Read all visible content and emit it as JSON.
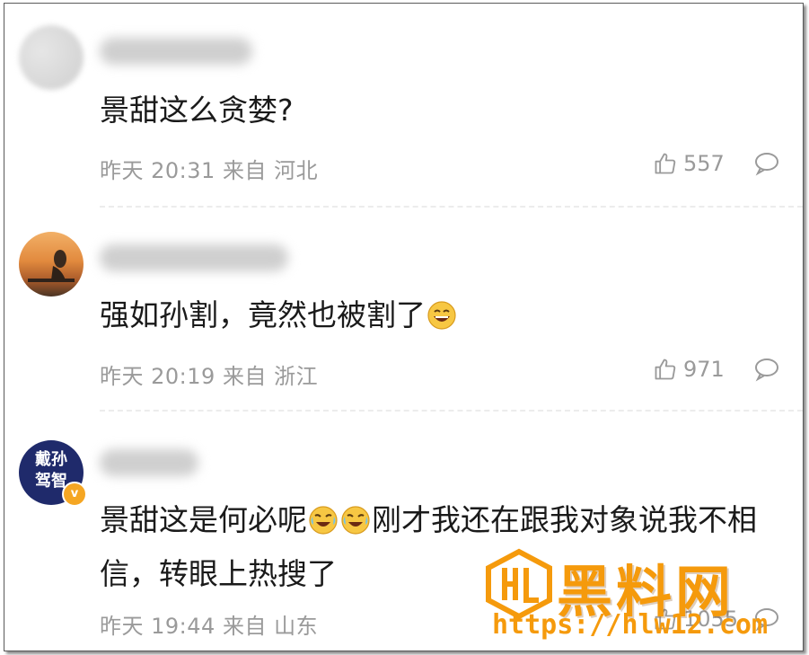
{
  "comments": [
    {
      "text": "景甜这么贪婪?",
      "time": "昨天 20:31",
      "from": "来自",
      "location": "河北",
      "likes": "557"
    },
    {
      "text": "强如孙割，竟然也被割了",
      "time": "昨天 20:19",
      "from": "来自",
      "location": "浙江",
      "likes": "971"
    },
    {
      "text_part1": "景甜这是何必呢",
      "text_part2": "刚才我还在跟我对象说我不相信，转眼上热搜了",
      "avatar_text_top": "戴孙",
      "avatar_text_bottom": "驾智",
      "badge": "v",
      "time": "昨天 19:44",
      "from": "来自",
      "location": "山东",
      "likes": "1055"
    }
  ],
  "watermark": {
    "title": "黑料网",
    "url": "https://hlw12.com",
    "color": "#f59a0c"
  },
  "colors": {
    "text": "#1a1a1a",
    "meta": "#9a9a9a",
    "verified_badge": "#f5a623"
  }
}
